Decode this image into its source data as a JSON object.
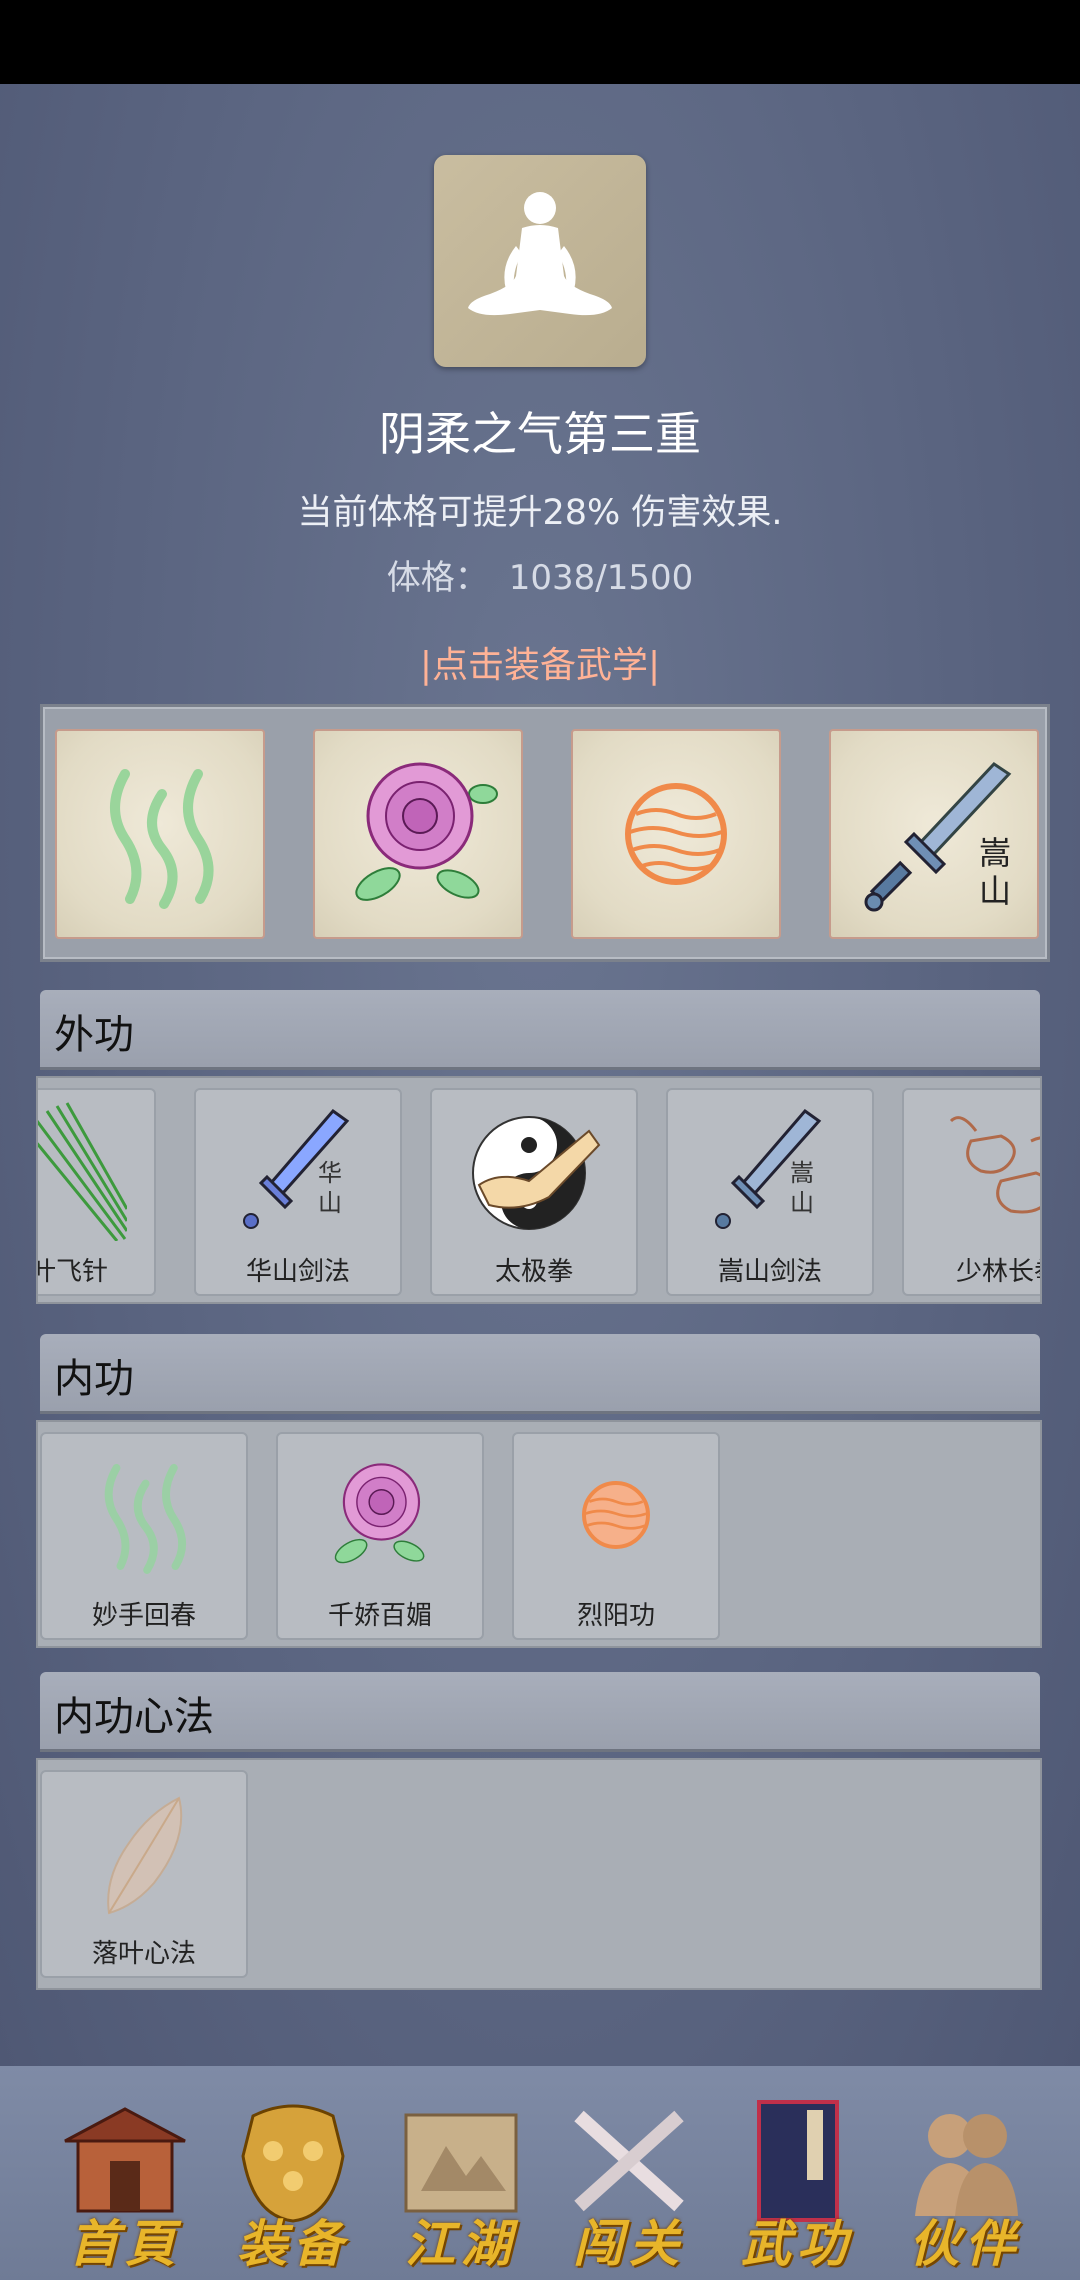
{
  "header": {
    "realm_title": "阴柔之气第三重",
    "description": "当前体格可提升28% 伤害效果.",
    "stat_label": "体格：",
    "stat_value": "1038/1500",
    "equip_link": "|点击装备武学|"
  },
  "equipped_slots": [
    {
      "icon": "green-wisps-icon"
    },
    {
      "icon": "rose-icon"
    },
    {
      "icon": "orange-sun-icon"
    },
    {
      "icon": "songshan-sword-icon",
      "text": "嵩山"
    }
  ],
  "sections": {
    "outer": {
      "title": "外功",
      "items": [
        {
          "label": "叶飞针",
          "icon": "needles-icon"
        },
        {
          "label": "华山剑法",
          "icon": "huashan-sword-icon",
          "text": "华山"
        },
        {
          "label": "太极拳",
          "icon": "taiji-fist-icon"
        },
        {
          "label": "嵩山剑法",
          "icon": "songshan-sword-icon",
          "text": "嵩山"
        },
        {
          "label": "少林长拳",
          "icon": "fists-icon"
        }
      ]
    },
    "inner": {
      "title": "内功",
      "items": [
        {
          "label": "妙手回春",
          "icon": "green-wisps-icon"
        },
        {
          "label": "千娇百媚",
          "icon": "rose-icon"
        },
        {
          "label": "烈阳功",
          "icon": "orange-sun-icon"
        }
      ]
    },
    "mind": {
      "title": "内功心法",
      "items": [
        {
          "label": "落叶心法",
          "icon": "leaf-icon"
        }
      ]
    }
  },
  "bottom_nav": [
    {
      "label": "首頁",
      "icon": "temple-icon"
    },
    {
      "label": "装备",
      "icon": "armor-icon"
    },
    {
      "label": "江湖",
      "icon": "scroll-map-icon"
    },
    {
      "label": "闯关",
      "icon": "crossed-swords-icon"
    },
    {
      "label": "武功",
      "icon": "book-icon"
    },
    {
      "label": "伙伴",
      "icon": "companions-icon"
    }
  ],
  "colors": {
    "accent": "#ffb296",
    "nav_text": "#e8b52a",
    "background": "#5a6480"
  }
}
